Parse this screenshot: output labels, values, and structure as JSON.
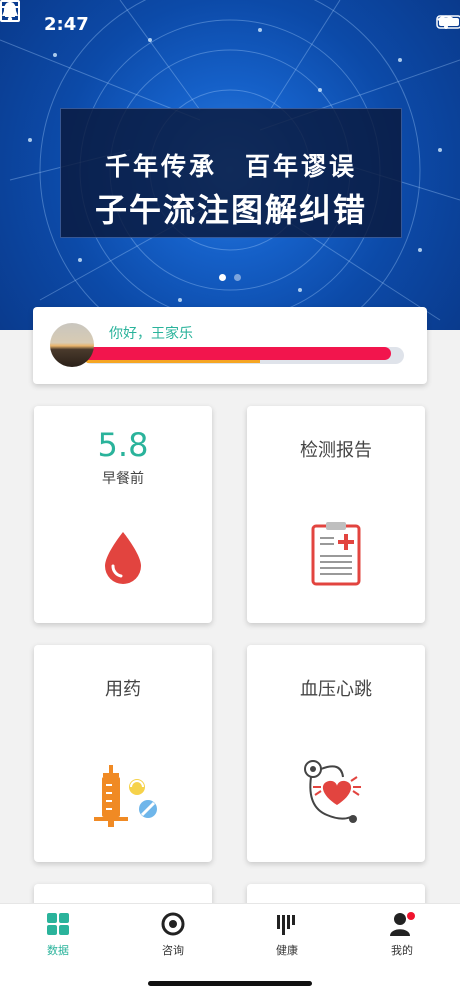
{
  "status": {
    "time": "2:47"
  },
  "banner": {
    "line1": "千年传承　百年谬误",
    "line2": "子午流注图解纠错",
    "dots": 2,
    "active_dot": 0
  },
  "profile": {
    "greeting": "你好，王家乐",
    "progress_fraction": 0.96,
    "sub_progress_fraction": 0.55
  },
  "cards": [
    {
      "value": "5.8",
      "sub": "早餐前",
      "icon": "blood-drop-icon"
    },
    {
      "title": "检测报告",
      "icon": "clipboard-report-icon"
    },
    {
      "title": "用药",
      "icon": "syringe-pills-icon"
    },
    {
      "title": "血压心跳",
      "icon": "stethoscope-heart-icon"
    }
  ],
  "tabbar": {
    "items": [
      {
        "label": "数据",
        "icon": "grid-icon",
        "active": true
      },
      {
        "label": "咨询",
        "icon": "target-icon",
        "active": false
      },
      {
        "label": "健康",
        "icon": "bars-icon",
        "active": false
      },
      {
        "label": "我的",
        "icon": "user-icon",
        "active": false,
        "badge": true
      }
    ]
  },
  "colors": {
    "accent": "#2ab39b",
    "progress": "#f2154d",
    "progress_sub": "#f5a623",
    "icon_red": "#e2443f"
  }
}
